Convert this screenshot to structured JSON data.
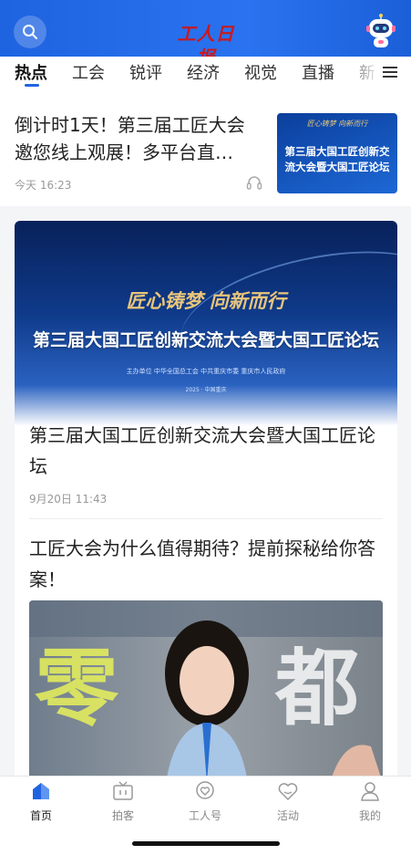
{
  "header": {
    "logo_text": "工人日报",
    "brand_color": "#1f63e0",
    "logo_color": "#c8191f"
  },
  "tabs": [
    {
      "label": "热点",
      "active": true
    },
    {
      "label": "工会"
    },
    {
      "label": "锐评"
    },
    {
      "label": "经济"
    },
    {
      "label": "视觉"
    },
    {
      "label": "直播"
    },
    {
      "label": "新"
    }
  ],
  "feed": {
    "article1": {
      "title": "倒计时1天！第三届工匠大会邀您线上观展！多平台直…",
      "time": "今天 16:23",
      "thumb_subtitle": "匠心铸梦 向新而行",
      "thumb_title": "第三届大国工匠创新交流大会暨大国工匠论坛"
    },
    "article2": {
      "banner_slogan": "匠心铸梦 向新而行",
      "banner_title": "第三届大国工匠创新交流大会暨大国工匠论坛",
      "banner_org": "主办单位  中华全国总工会  中共重庆市委  重庆市人民政府",
      "banner_date": "2025 · 中国重庆",
      "title": "第三届大国工匠创新交流大会暨大国工匠论坛",
      "time": "9月20日 11:43"
    },
    "article3": {
      "title": "工匠大会为什么值得期待？提前探秘给你答案！",
      "photo_caption_left": "零",
      "photo_caption_right": "都"
    }
  },
  "bottom_nav": [
    {
      "label": "首页",
      "icon": "home-icon",
      "active": true
    },
    {
      "label": "拍客",
      "icon": "tv-icon"
    },
    {
      "label": "工人号",
      "icon": "chat-heart-icon"
    },
    {
      "label": "活动",
      "icon": "heart-icon"
    },
    {
      "label": "我的",
      "icon": "user-icon"
    }
  ]
}
